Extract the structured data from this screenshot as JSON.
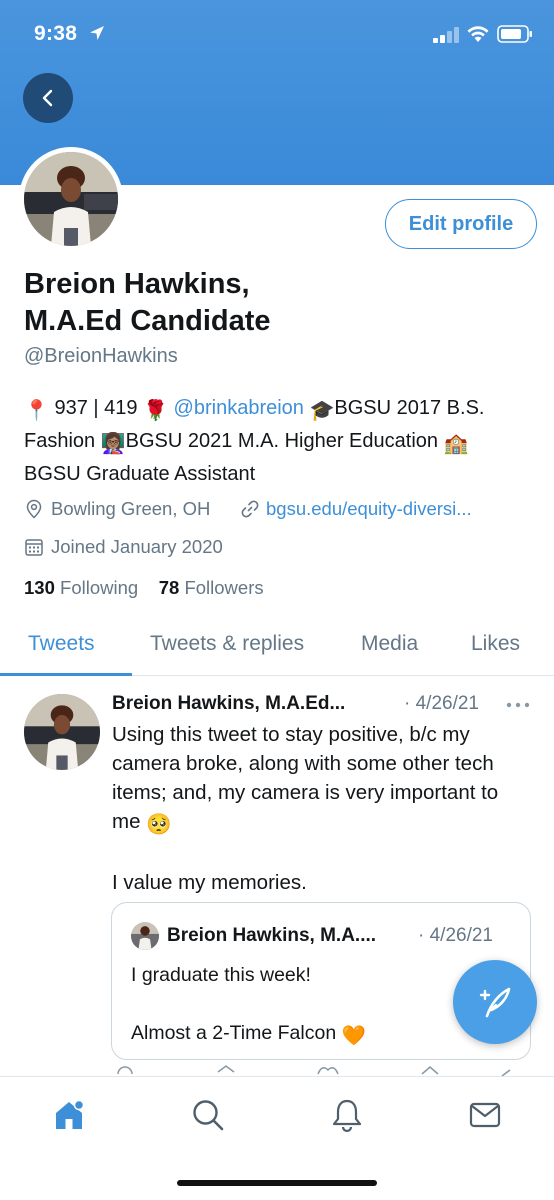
{
  "status_bar": {
    "time": "9:38"
  },
  "profile": {
    "display_name_line1": "Breion Hawkins,",
    "display_name_line2": "M.A.Ed Candidate",
    "handle": "@BreionHawkins",
    "edit_profile_label": "Edit profile",
    "bio": {
      "part1": " 937 | 419 ",
      "mention": "@brinkabreion",
      "part2": "BGSU 2017 B.S. Fashion ",
      "part3": "BGSU 2021 M.A. Higher Education ",
      "part4": "BGSU Graduate Assistant",
      "emojis": {
        "pin": "📍",
        "rose": "🌹",
        "cap": "🎓",
        "teacher": "👩🏽‍🏫",
        "school": "🏫"
      }
    },
    "location": "Bowling Green, OH",
    "website": "bgsu.edu/equity-diversi...",
    "joined": "Joined January 2020",
    "following_count": "130",
    "following_label": "Following",
    "followers_count": "78",
    "followers_label": "Followers"
  },
  "tabs": [
    {
      "label": "Tweets",
      "active": true
    },
    {
      "label": "Tweets & replies",
      "active": false
    },
    {
      "label": "Media",
      "active": false
    },
    {
      "label": "Likes",
      "active": false
    }
  ],
  "tweet": {
    "author": "Breion Hawkins, M.A.Ed...",
    "date": "· 4/26/21",
    "text_line1": "Using this tweet to stay positive, b/c my camera broke, along with some other tech items; and, my camera is very important to me ",
    "emoji": "🥺",
    "text_line2": "I value my memories.",
    "quote": {
      "author": "Breion Hawkins, M.A....",
      "date": "· 4/26/21",
      "line1": "I graduate this week!",
      "line2": "Almost a 2-Time Falcon ",
      "emoji": "🧡"
    }
  },
  "colors": {
    "accent": "#3d8fd8",
    "banner": "#4a95dd",
    "muted": "#657786",
    "text": "#14171a"
  },
  "icons": {
    "back": "chevron-left-icon",
    "location": "location-pin-icon",
    "link": "link-icon",
    "calendar": "calendar-icon",
    "compose": "compose-tweet-icon",
    "nav": [
      "home-icon",
      "search-icon",
      "notifications-bell-icon",
      "messages-mail-icon"
    ]
  }
}
